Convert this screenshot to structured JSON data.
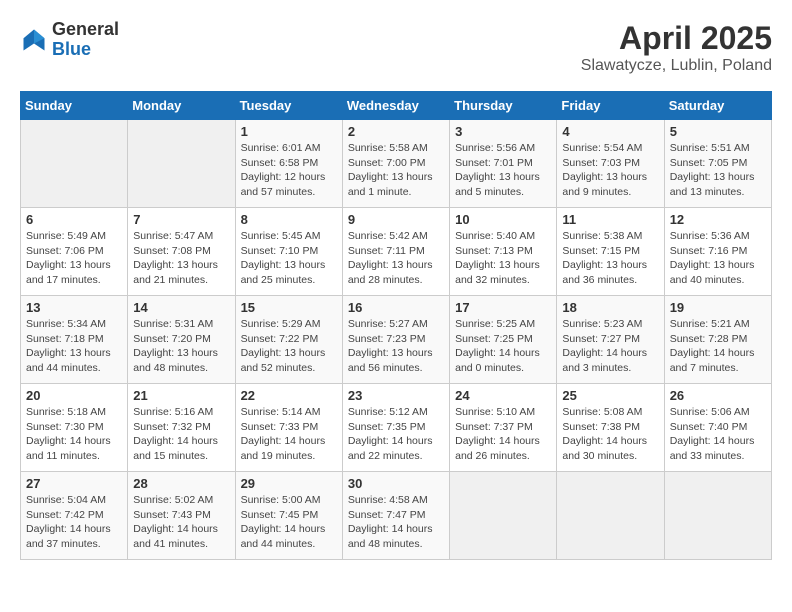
{
  "header": {
    "logo": {
      "general": "General",
      "blue": "Blue"
    },
    "title": "April 2025",
    "location": "Slawatycze, Lublin, Poland"
  },
  "days_of_week": [
    "Sunday",
    "Monday",
    "Tuesday",
    "Wednesday",
    "Thursday",
    "Friday",
    "Saturday"
  ],
  "weeks": [
    [
      {
        "day": "",
        "info": ""
      },
      {
        "day": "",
        "info": ""
      },
      {
        "day": "1",
        "info": "Sunrise: 6:01 AM\nSunset: 6:58 PM\nDaylight: 12 hours\nand 57 minutes."
      },
      {
        "day": "2",
        "info": "Sunrise: 5:58 AM\nSunset: 7:00 PM\nDaylight: 13 hours\nand 1 minute."
      },
      {
        "day": "3",
        "info": "Sunrise: 5:56 AM\nSunset: 7:01 PM\nDaylight: 13 hours\nand 5 minutes."
      },
      {
        "day": "4",
        "info": "Sunrise: 5:54 AM\nSunset: 7:03 PM\nDaylight: 13 hours\nand 9 minutes."
      },
      {
        "day": "5",
        "info": "Sunrise: 5:51 AM\nSunset: 7:05 PM\nDaylight: 13 hours\nand 13 minutes."
      }
    ],
    [
      {
        "day": "6",
        "info": "Sunrise: 5:49 AM\nSunset: 7:06 PM\nDaylight: 13 hours\nand 17 minutes."
      },
      {
        "day": "7",
        "info": "Sunrise: 5:47 AM\nSunset: 7:08 PM\nDaylight: 13 hours\nand 21 minutes."
      },
      {
        "day": "8",
        "info": "Sunrise: 5:45 AM\nSunset: 7:10 PM\nDaylight: 13 hours\nand 25 minutes."
      },
      {
        "day": "9",
        "info": "Sunrise: 5:42 AM\nSunset: 7:11 PM\nDaylight: 13 hours\nand 28 minutes."
      },
      {
        "day": "10",
        "info": "Sunrise: 5:40 AM\nSunset: 7:13 PM\nDaylight: 13 hours\nand 32 minutes."
      },
      {
        "day": "11",
        "info": "Sunrise: 5:38 AM\nSunset: 7:15 PM\nDaylight: 13 hours\nand 36 minutes."
      },
      {
        "day": "12",
        "info": "Sunrise: 5:36 AM\nSunset: 7:16 PM\nDaylight: 13 hours\nand 40 minutes."
      }
    ],
    [
      {
        "day": "13",
        "info": "Sunrise: 5:34 AM\nSunset: 7:18 PM\nDaylight: 13 hours\nand 44 minutes."
      },
      {
        "day": "14",
        "info": "Sunrise: 5:31 AM\nSunset: 7:20 PM\nDaylight: 13 hours\nand 48 minutes."
      },
      {
        "day": "15",
        "info": "Sunrise: 5:29 AM\nSunset: 7:22 PM\nDaylight: 13 hours\nand 52 minutes."
      },
      {
        "day": "16",
        "info": "Sunrise: 5:27 AM\nSunset: 7:23 PM\nDaylight: 13 hours\nand 56 minutes."
      },
      {
        "day": "17",
        "info": "Sunrise: 5:25 AM\nSunset: 7:25 PM\nDaylight: 14 hours\nand 0 minutes."
      },
      {
        "day": "18",
        "info": "Sunrise: 5:23 AM\nSunset: 7:27 PM\nDaylight: 14 hours\nand 3 minutes."
      },
      {
        "day": "19",
        "info": "Sunrise: 5:21 AM\nSunset: 7:28 PM\nDaylight: 14 hours\nand 7 minutes."
      }
    ],
    [
      {
        "day": "20",
        "info": "Sunrise: 5:18 AM\nSunset: 7:30 PM\nDaylight: 14 hours\nand 11 minutes."
      },
      {
        "day": "21",
        "info": "Sunrise: 5:16 AM\nSunset: 7:32 PM\nDaylight: 14 hours\nand 15 minutes."
      },
      {
        "day": "22",
        "info": "Sunrise: 5:14 AM\nSunset: 7:33 PM\nDaylight: 14 hours\nand 19 minutes."
      },
      {
        "day": "23",
        "info": "Sunrise: 5:12 AM\nSunset: 7:35 PM\nDaylight: 14 hours\nand 22 minutes."
      },
      {
        "day": "24",
        "info": "Sunrise: 5:10 AM\nSunset: 7:37 PM\nDaylight: 14 hours\nand 26 minutes."
      },
      {
        "day": "25",
        "info": "Sunrise: 5:08 AM\nSunset: 7:38 PM\nDaylight: 14 hours\nand 30 minutes."
      },
      {
        "day": "26",
        "info": "Sunrise: 5:06 AM\nSunset: 7:40 PM\nDaylight: 14 hours\nand 33 minutes."
      }
    ],
    [
      {
        "day": "27",
        "info": "Sunrise: 5:04 AM\nSunset: 7:42 PM\nDaylight: 14 hours\nand 37 minutes."
      },
      {
        "day": "28",
        "info": "Sunrise: 5:02 AM\nSunset: 7:43 PM\nDaylight: 14 hours\nand 41 minutes."
      },
      {
        "day": "29",
        "info": "Sunrise: 5:00 AM\nSunset: 7:45 PM\nDaylight: 14 hours\nand 44 minutes."
      },
      {
        "day": "30",
        "info": "Sunrise: 4:58 AM\nSunset: 7:47 PM\nDaylight: 14 hours\nand 48 minutes."
      },
      {
        "day": "",
        "info": ""
      },
      {
        "day": "",
        "info": ""
      },
      {
        "day": "",
        "info": ""
      }
    ]
  ]
}
